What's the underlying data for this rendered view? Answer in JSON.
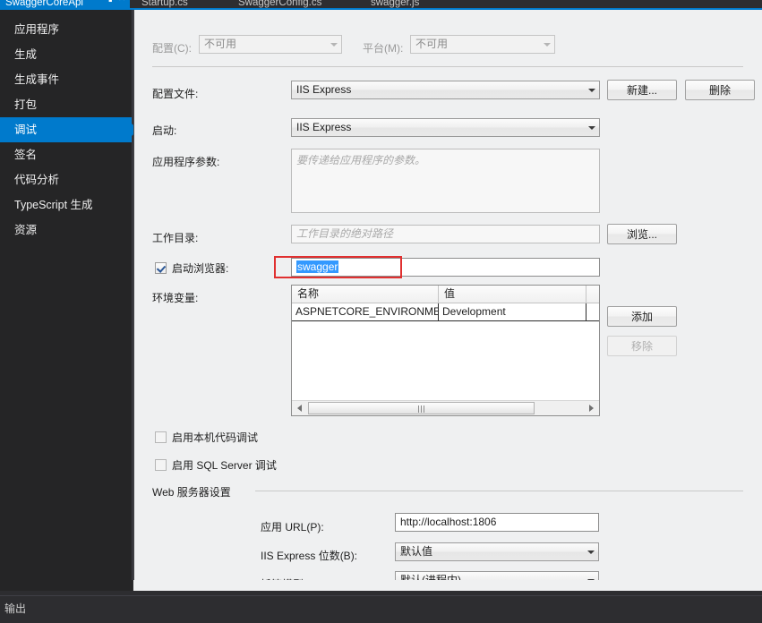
{
  "window": {
    "active_tab": "SwaggerCoreApi",
    "pin_icon": "pin-icon",
    "close_icon": "close-icon",
    "tabs": [
      {
        "label": "SwaggerCoreApi",
        "active": true
      },
      {
        "label": "Startup.cs",
        "active": false
      },
      {
        "label": "SwaggerConfig.cs",
        "active": false
      },
      {
        "label": "swagger.js",
        "active": false
      }
    ]
  },
  "sidebar": {
    "items": [
      {
        "label": "应用程序",
        "selected": false
      },
      {
        "label": "生成",
        "selected": false
      },
      {
        "label": "生成事件",
        "selected": false
      },
      {
        "label": "打包",
        "selected": false
      },
      {
        "label": "调试",
        "selected": true
      },
      {
        "label": "签名",
        "selected": false
      },
      {
        "label": "代码分析",
        "selected": false
      },
      {
        "label": "TypeScript 生成",
        "selected": false
      },
      {
        "label": "资源",
        "selected": false
      }
    ]
  },
  "toolbar": {
    "configuration_label": "配置(C):",
    "configuration_value": "不可用",
    "platform_label": "平台(M):",
    "platform_value": "不可用"
  },
  "form": {
    "profile_label": "配置文件:",
    "profile_value": "IIS Express",
    "new_button": "新建...",
    "delete_button": "删除",
    "launch_label": "启动:",
    "launch_value": "IIS Express",
    "app_args_label": "应用程序参数:",
    "app_args_placeholder": "要传递给应用程序的参数。",
    "working_dir_label": "工作目录:",
    "working_dir_placeholder": "工作目录的绝对路径",
    "browse_button": "浏览...",
    "launch_browser_label": "启动浏览器:",
    "launch_browser_checked": true,
    "launch_browser_value": "swagger",
    "env_vars_label": "环境变量:",
    "env_header_name": "名称",
    "env_header_value": "值",
    "env_rows": [
      {
        "name": "ASPNETCORE_ENVIRONMENT",
        "value": "Development"
      }
    ],
    "add_button": "添加",
    "remove_button": "移除",
    "remove_disabled": true,
    "native_debug_label": "启用本机代码调试",
    "native_debug_checked": false,
    "sql_debug_label": "启用 SQL Server 调试",
    "sql_debug_checked": false,
    "web_server_group": "Web 服务器设置",
    "app_url_label": "应用 URL(P):",
    "app_url_value": "http://localhost:1806",
    "iis_bitness_label": "IIS Express 位数(B):",
    "iis_bitness_value": "默认值",
    "hosting_model_label": "托管模型(M):",
    "hosting_model_value": "默认(进程内)"
  },
  "output": {
    "label": "输出"
  },
  "colors": {
    "accent": "#007acc",
    "annotation": "#e03030",
    "selection": "#3399ff",
    "pane_bg": "#eff0f1",
    "nav_bg": "#252526"
  }
}
